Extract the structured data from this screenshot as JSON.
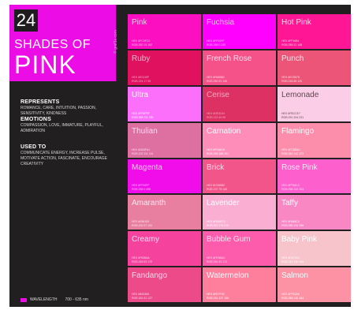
{
  "title": {
    "number": "24",
    "line1": "SHADES OF",
    "line2": "PINK",
    "credit": "© graf1x.com"
  },
  "represents": {
    "heading": "REPRESENTS",
    "text": "ROMANCE, CARE, INTUITION, PASSION, SENSITIVITY, KINDNESS"
  },
  "emotions": {
    "heading": "EMOTIONS",
    "text": "COMPASSION, LOVE, IMMATURE, PLAYFUL, ADMIRATION"
  },
  "used_to": {
    "heading": "USED TO",
    "text": "COMMUNICATE ENERGY, INCREASE PULSE, MOTIVATE ACTION, FASCINATE, ENCOURAGE CREATIVITY"
  },
  "legend": {
    "label": "WAVELENGTH",
    "range": "700 - 635 nm",
    "color": "#ec0ce5"
  },
  "swatches": [
    {
      "name": "Pink",
      "hex": "HEX #FC0FC0",
      "rgb": "RGB 252 15 192",
      "color": "#fc0fc0",
      "text": "#f3c7ec"
    },
    {
      "name": "Fuchsia",
      "hex": "HEX #FF00FF",
      "rgb": "RGB 255 0 255",
      "color": "#ff00ff",
      "text": "#f6c4f1"
    },
    {
      "name": "Hot Pink",
      "hex": "HEX #FF1694",
      "rgb": "RGB 255 22 148",
      "color": "#ff1694",
      "text": "#ffd6ea"
    },
    {
      "name": "Ruby",
      "hex": "HEX #E0115F",
      "rgb": "RGB 224 17 95",
      "color": "#e0115f",
      "text": "#f2b3c7"
    },
    {
      "name": "French Rose",
      "hex": "HEX #FA5B8C",
      "rgb": "RGB 250 91 140",
      "color": "#f6528a",
      "text": "#ffe1ea"
    },
    {
      "name": "Punch",
      "hex": "HEX #EC5578",
      "rgb": "RGB 236 85 120",
      "color": "#ec5578",
      "text": "#ffe1e8"
    },
    {
      "name": "Ultra",
      "hex": "HEX #FF6FFF",
      "rgb": "RGB 255 111 255",
      "color": "#fc6ffb",
      "text": "#ffffff"
    },
    {
      "name": "Cerise",
      "hex": "HEX #DE3163",
      "rgb": "RGB 222 49 99",
      "color": "#de3163",
      "text": "#f5aac1"
    },
    {
      "name": "Lemonade",
      "hex": "HEX #FBCCE7",
      "rgb": "RGB 251 204 231",
      "color": "#fccde6",
      "text": "#5a4a52"
    },
    {
      "name": "Thulian",
      "hex": "HEX #DE6FA1",
      "rgb": "RGB 222 111 161",
      "color": "#de6fa1",
      "text": "#ffe0ef"
    },
    {
      "name": "Carnation",
      "hex": "HEX #FFA6C9",
      "rgb": "RGB 255 166 201",
      "color": "#fe8db9",
      "text": "#ffffff"
    },
    {
      "name": "Flamingo",
      "hex": "HEX #FC8EAC",
      "rgb": "RGB 252 142 172",
      "color": "#fc8eac",
      "text": "#ffffff"
    },
    {
      "name": "Magenta",
      "hex": "HEX #FF00FF",
      "rgb": "RGB 255 0 255",
      "color": "#f10dea",
      "text": "#f8c6f2"
    },
    {
      "name": "Brick",
      "hex": "HEX #C54B8C",
      "rgb": "RGB 197 75 140",
      "color": "#f2558a",
      "text": "#ffdcea"
    },
    {
      "name": "Rose Pink",
      "hex": "HEX #FF66CC",
      "rgb": "RGB 255 102 204",
      "color": "#fd5fcc",
      "text": "#ffe6f7"
    },
    {
      "name": "Amaranth",
      "hex": "HEX #E86100",
      "rgb": "RGB 232 97 100",
      "color": "#e87fa1",
      "text": "#ffe6ee"
    },
    {
      "name": "Lavender",
      "hex": "HEX #FBAED2",
      "rgb": "RGB 251 174 210",
      "color": "#f9aed2",
      "text": "#ffffff"
    },
    {
      "name": "Taffy",
      "hex": "HEX #FA86C4",
      "rgb": "RGB 250 134 196",
      "color": "#f987c4",
      "text": "#ffffff"
    },
    {
      "name": "Creamy",
      "hex": "HEX #F535AA",
      "rgb": "RGB 245 53 170",
      "color": "#f5429d",
      "text": "#ffdff0"
    },
    {
      "name": "Bubble Gum",
      "hex": "HEX #FE5BAC",
      "rgb": "RGB 254 91 172",
      "color": "#fd5bac",
      "text": "#ffe3f1"
    },
    {
      "name": "Baby Pink",
      "hex": "HEX #F4C2C2",
      "rgb": "RGB 244 194 194",
      "color": "#f6c4ca",
      "text": "#ffffff"
    },
    {
      "name": "Fandango",
      "hex": "HEX #B53389",
      "rgb": "RGB 181 51 137",
      "color": "#ed4a8a",
      "text": "#ffd7e8"
    },
    {
      "name": "Watermelon",
      "hex": "HEX #FE7F9C",
      "rgb": "RGB 254 127 156",
      "color": "#fd7f9c",
      "text": "#ffffff"
    },
    {
      "name": "Salmon",
      "hex": "HEX #FF91A4",
      "rgb": "RGB 255 145 164",
      "color": "#fd92a4",
      "text": "#ffffff"
    }
  ]
}
